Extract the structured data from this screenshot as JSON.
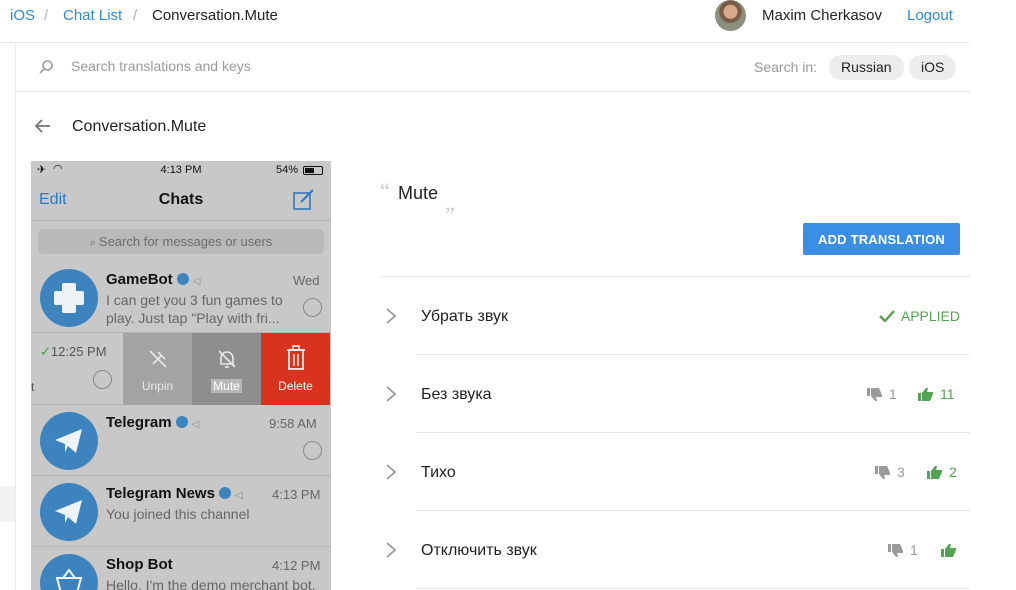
{
  "breadcrumb": {
    "items": [
      "iOS",
      "Chat List"
    ],
    "separator": "/",
    "current": "Conversation.Mute"
  },
  "user": {
    "name": "Maxim Cherkasov",
    "logout_label": "Logout"
  },
  "search": {
    "placeholder": "Search translations and keys",
    "search_in_label": "Search in:",
    "scopes": [
      "Russian",
      "iOS"
    ]
  },
  "key": {
    "title": "Conversation.Mute"
  },
  "screenshot": {
    "status_time": "4:13 PM",
    "battery": "54%",
    "nav_edit": "Edit",
    "nav_title": "Chats",
    "search_placeholder": "Search for messages or users",
    "chats": [
      {
        "name": "GameBot",
        "time": "Wed",
        "message": "I can get you 3 fun games to play. Just tap \"Play with fri..."
      },
      {
        "name": "Telegram",
        "time": "9:58 AM",
        "message": ""
      },
      {
        "name": "Telegram News",
        "time": "4:13 PM",
        "message": "You joined this channel"
      },
      {
        "name": "Shop Bot",
        "time": "4:12 PM",
        "message": "Hello, I'm the demo merchant bot."
      }
    ],
    "swiped_row": {
      "time": "12:25 PM",
      "actions": [
        "Unpin",
        "Mute",
        "Delete"
      ]
    }
  },
  "source": {
    "text": "Mute"
  },
  "add_translation_label": "ADD TRANSLATION",
  "translations": [
    {
      "text": "Убрать звук",
      "applied": true,
      "applied_label": "APPLIED"
    },
    {
      "text": "Без звука",
      "down": "1",
      "up": "11"
    },
    {
      "text": "Тихо",
      "down": "3",
      "up": "2"
    },
    {
      "text": "Отключить звук",
      "down": "1",
      "up": ""
    }
  ],
  "colors": {
    "accent": "#2d8bd6",
    "button": "#3a8ee6",
    "positive": "#52a352",
    "delete": "#d9331f"
  }
}
